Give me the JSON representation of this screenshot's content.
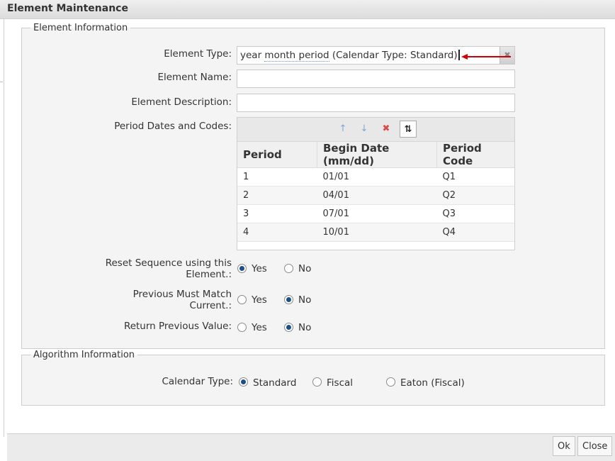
{
  "dialog": {
    "title": "Element Maintenance"
  },
  "element_info": {
    "legend": "Element Information",
    "element_type_label": "Element Type:",
    "element_type_value": {
      "prefix": "year ",
      "underlined": "month period",
      "suffix": " (Calendar Type: Standard)"
    },
    "element_name_label": "Element Name:",
    "element_name_value": "",
    "element_description_label": "Element Description:",
    "element_description_value": "",
    "period_label": "Period Dates and Codes:",
    "grid": {
      "columns": [
        "Period",
        "Begin Date (mm/dd)",
        "Period Code"
      ],
      "rows": [
        [
          "1",
          "01/01",
          "Q1"
        ],
        [
          "2",
          "04/01",
          "Q2"
        ],
        [
          "3",
          "07/01",
          "Q3"
        ],
        [
          "4",
          "10/01",
          "Q4"
        ]
      ]
    },
    "reset_label_line1": "Reset Sequence using this",
    "reset_label_line2": "Element.:",
    "prev_match_label_line1": "Previous Must Match",
    "prev_match_label_line2": "Current.:",
    "return_prev_label": "Return Previous Value:",
    "yes": "Yes",
    "no": "No",
    "reset_selected": "Yes",
    "prev_match_selected": "No",
    "return_prev_selected": "No"
  },
  "algorithm_info": {
    "legend": "Algorithm Information",
    "calendar_type_label": "Calendar Type:",
    "options": [
      "Standard",
      "Fiscal",
      "Eaton (Fiscal)"
    ],
    "selected": "Standard"
  },
  "footer": {
    "ok_label": "Ok",
    "close_label": "Close"
  },
  "colors": {
    "annotation_arrow": "#d00000",
    "radio_selected": "#1b4f87"
  }
}
